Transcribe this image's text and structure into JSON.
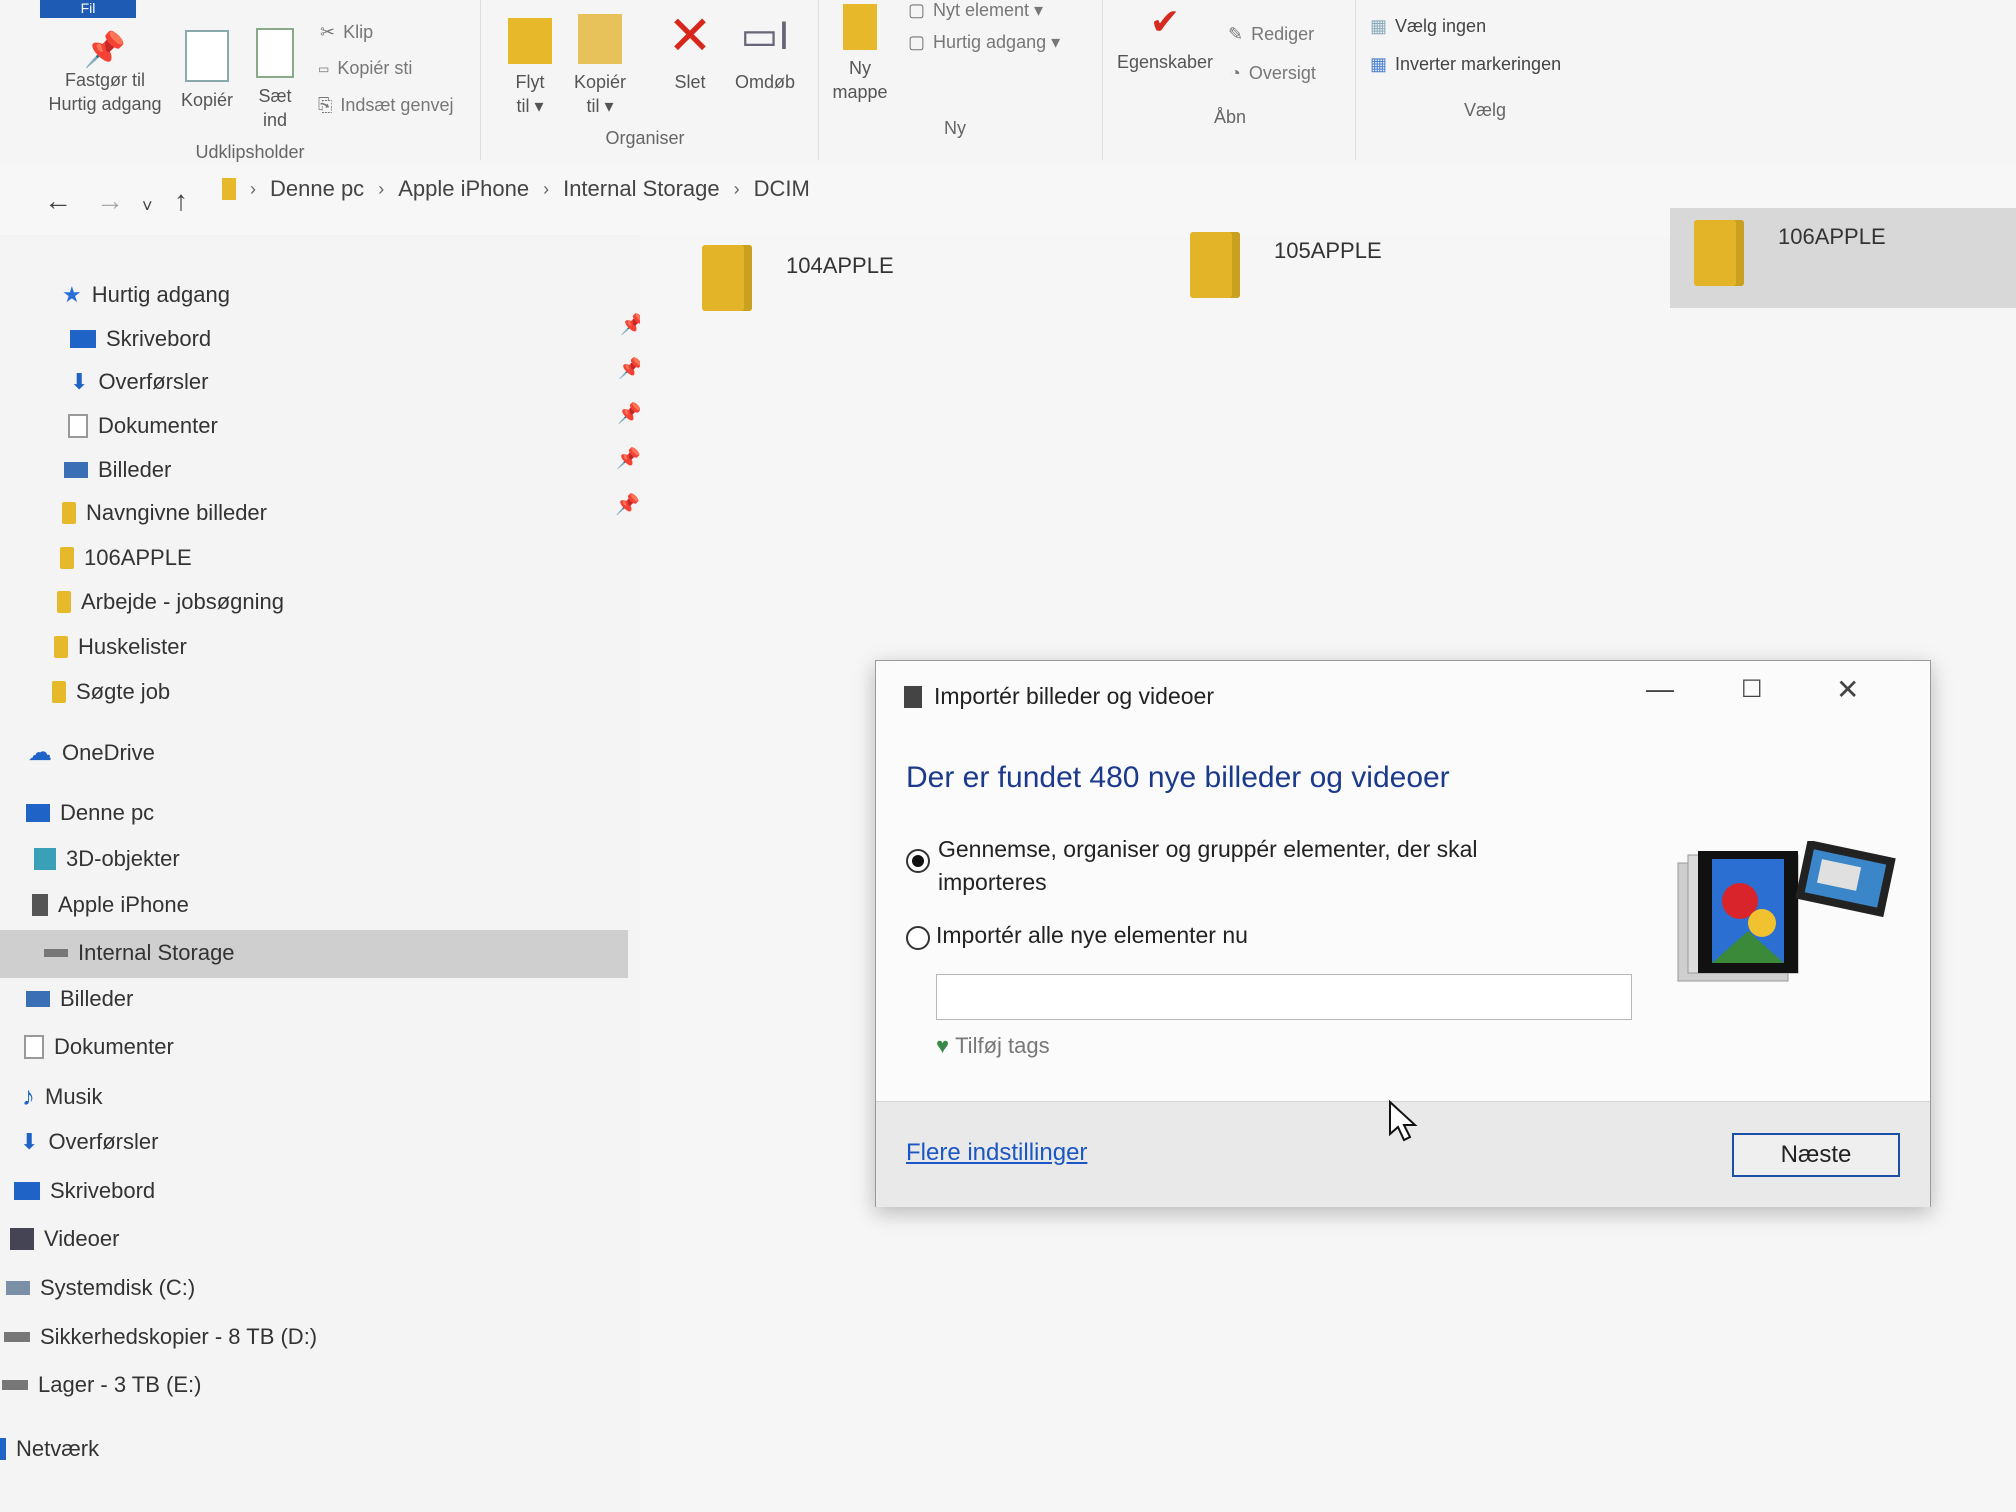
{
  "ribbon": {
    "file_tab": "Fil",
    "pin_quick": "Fastgør til\nHurtig adgang",
    "copy": "Kopiér",
    "paste": "Sæt\nind",
    "cut": "Klip",
    "copy_path": "Kopiér sti",
    "paste_shortcut": "Indsæt genvej",
    "clipboard_group": "Udklipsholder",
    "move_to": "Flyt\ntil ▾",
    "copy_to": "Kopiér\ntil ▾",
    "delete": "Slet",
    "rename": "Omdøb",
    "organize_group": "Organiser",
    "new_folder": "Ny\nmappe",
    "new_item": "Nyt element ▾",
    "quick_access": "Hurtig adgang ▾",
    "new_group": "Ny",
    "properties": "Egenskaber",
    "edit": "Rediger",
    "history": "Oversigt",
    "open_group": "Åbn",
    "select_none": "Vælg ingen",
    "invert_selection": "Inverter markeringen",
    "select_group": "Vælg"
  },
  "breadcrumb": [
    "Denne pc",
    "Apple iPhone",
    "Internal Storage",
    "DCIM"
  ],
  "sidebar": {
    "quick_access": "Hurtig adgang",
    "pinned": [
      "Skrivebord",
      "Overførsler",
      "Dokumenter",
      "Billeder",
      "Navngivne billeder"
    ],
    "recent": [
      "106APPLE",
      "Arbejde - jobsøgning",
      "Huskelister",
      "Søgte job"
    ],
    "onedrive": "OneDrive",
    "this_pc": "Denne pc",
    "objects3d": "3D-objekter",
    "iphone": "Apple iPhone",
    "internal_storage": "Internal Storage",
    "pc_items": [
      "Billeder",
      "Dokumenter",
      "Musik",
      "Overførsler",
      "Skrivebord",
      "Videoer",
      "Systemdisk (C:)",
      "Sikkerhedskopier - 8 TB (D:)",
      "Lager - 3 TB (E:)"
    ],
    "network": "Netværk"
  },
  "folders": [
    "104APPLE",
    "105APPLE",
    "106APPLE"
  ],
  "dialog": {
    "title": "Importér billeder og videoer",
    "heading": "Der er fundet 480 nye billeder og videoer",
    "option1": "Gennemse, organiser og gruppér elementer, der skal importeres",
    "option2": "Importér alle nye elementer nu",
    "tags_value": "",
    "add_tags": "Tilføj tags",
    "more_settings": "Flere indstillinger",
    "next": "Næste"
  }
}
